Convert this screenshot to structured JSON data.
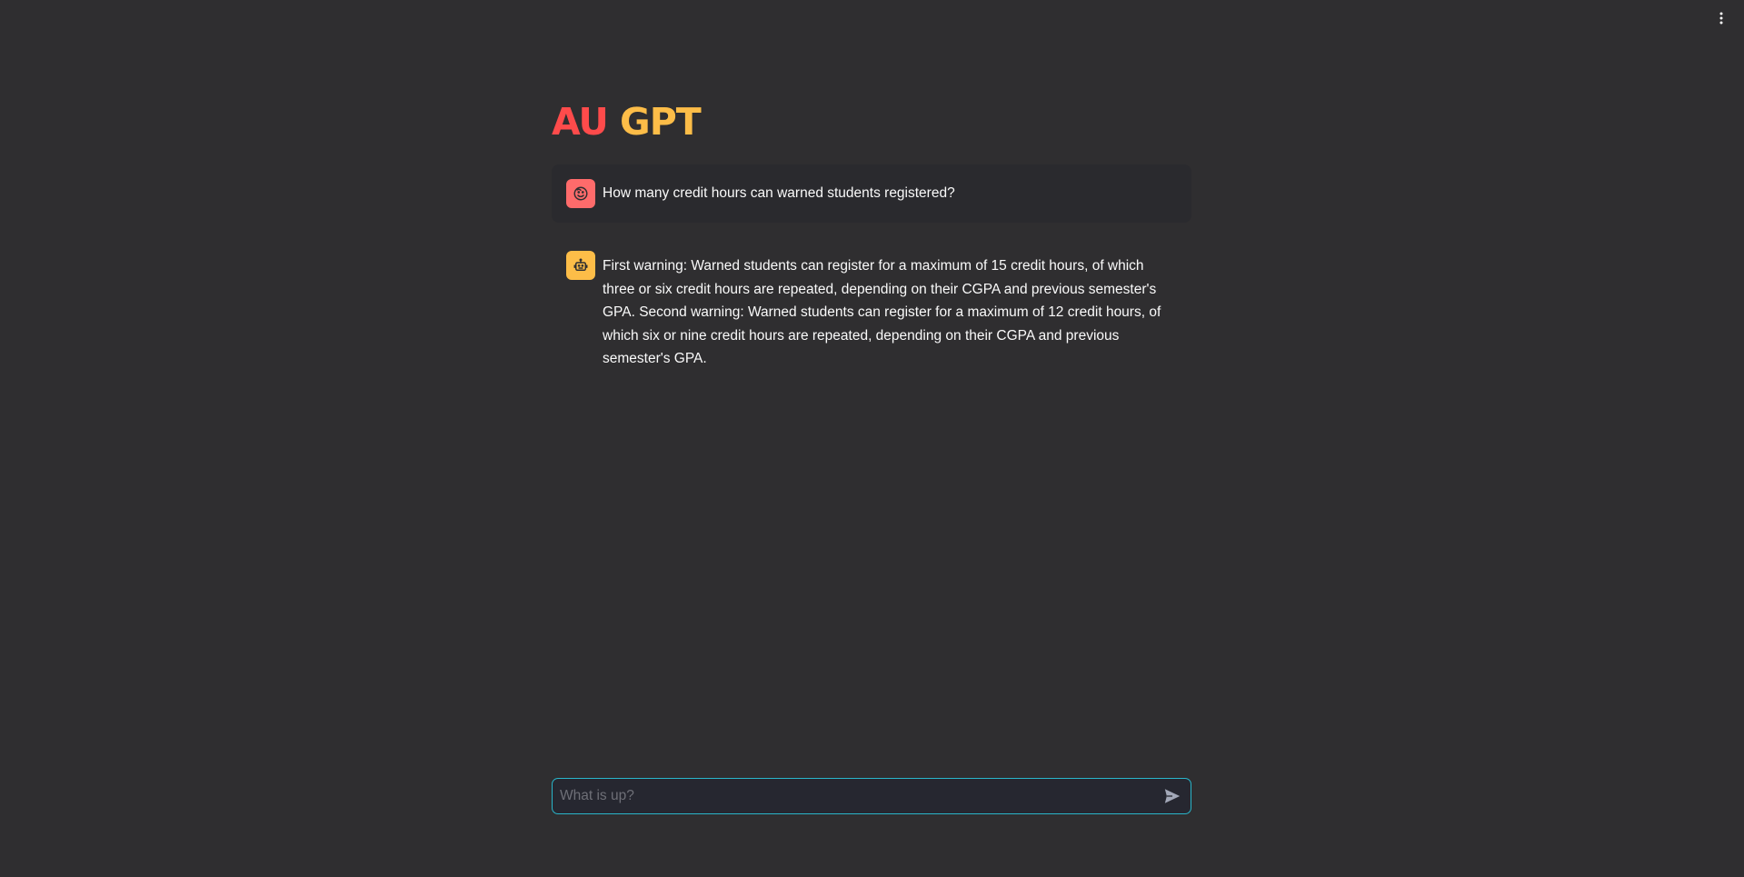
{
  "header": {
    "title_part1": "AU",
    "title_part2": "GPT",
    "menu_icon": "vertical-ellipsis-icon"
  },
  "messages": [
    {
      "role": "user",
      "avatar_icon": "face-smile-icon",
      "text": "How many credit hours can warned students registered?"
    },
    {
      "role": "assistant",
      "avatar_icon": "robot-icon",
      "text": "First warning: Warned students can register for a maximum of 15 credit hours, of which three or six credit hours are repeated, depending on their CGPA and previous semester's GPA. Second warning: Warned students can register for a maximum of 12 credit hours, of which six or nine credit hours are repeated, depending on their CGPA and previous semester's GPA."
    }
  ],
  "chat_input": {
    "placeholder": "What is up?",
    "value": "",
    "send_icon": "send-icon"
  },
  "colors": {
    "background": "#2f2e30",
    "title_au": "#fe4b4b",
    "title_gpt": "#fdbd48",
    "user_avatar": "#fe6b6b",
    "bot_avatar": "#fdbd48",
    "input_border": "#29b5c9"
  }
}
